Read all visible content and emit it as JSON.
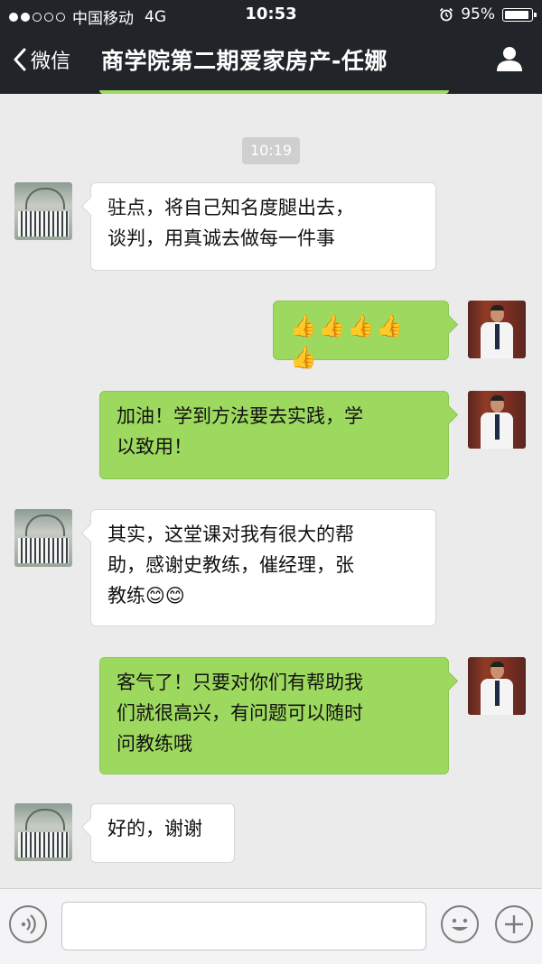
{
  "status_bar": {
    "carrier": "中国移动",
    "network": "4G",
    "time": "10:53",
    "battery": "95%"
  },
  "nav": {
    "back_label": "微信",
    "title": "商学院第二期爱家房产-任娜"
  },
  "chat": {
    "timestamp": "10:19",
    "messages": [
      {
        "side": "left",
        "text": "驻点，将自己知名度腿出去，\n谈判，用真诚去做每一件事"
      },
      {
        "side": "right",
        "text": "👍👍👍👍👍"
      },
      {
        "side": "right",
        "text": "加油！学到方法要去实践，学\n以致用！"
      },
      {
        "side": "left",
        "text": "其实，这堂课对我有很大的帮\n助，感谢史教练，催经理，张\n教练😊😊"
      },
      {
        "side": "right",
        "text": "客气了！只要对你们有帮助我\n们就很高兴，有问题可以随时\n问教练哦"
      },
      {
        "side": "left",
        "text": "好的，谢谢"
      }
    ]
  },
  "input_bar": {
    "voice_icon": "voice-icon",
    "emoji_icon": "emoji-icon",
    "plus_icon": "plus-icon"
  },
  "colors": {
    "header_bg": "#21252a",
    "chat_bg": "#ebebeb",
    "sent_bubble": "#9ed95f",
    "received_bubble": "#ffffff"
  }
}
